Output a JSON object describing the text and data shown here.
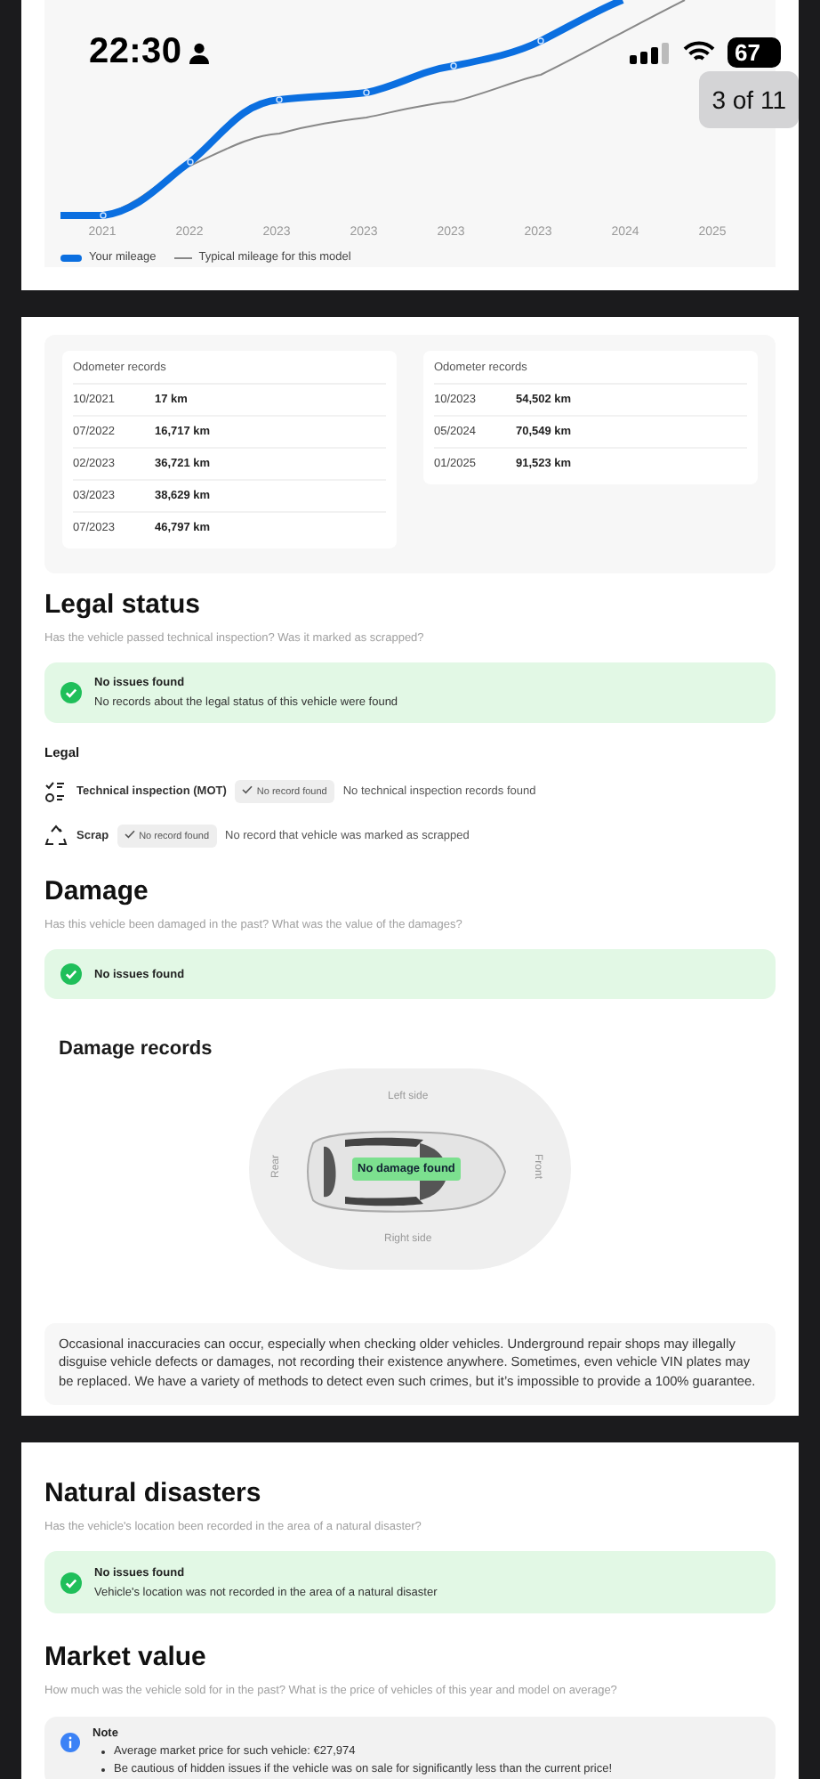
{
  "status_bar": {
    "time": "22:30",
    "battery": "67"
  },
  "page_indicator": "3 of 11",
  "mileage_chart": {
    "x_labels": [
      "2021",
      "2022",
      "2023",
      "2023",
      "2023",
      "2023",
      "2024",
      "2025"
    ],
    "legend": [
      {
        "label": "Your mileage",
        "kind": "user"
      },
      {
        "label": "Typical mileage for this model",
        "kind": "typical"
      }
    ]
  },
  "odometer": {
    "tables": [
      {
        "title": "Odometer records",
        "rows": [
          {
            "date": "10/2021",
            "km": "17 km"
          },
          {
            "date": "07/2022",
            "km": "16,717 km"
          },
          {
            "date": "02/2023",
            "km": "36,721 km"
          },
          {
            "date": "03/2023",
            "km": "38,629 km"
          },
          {
            "date": "07/2023",
            "km": "46,797 km"
          }
        ]
      },
      {
        "title": "Odometer records",
        "rows": [
          {
            "date": "10/2023",
            "km": "54,502 km"
          },
          {
            "date": "05/2024",
            "km": "70,549 km"
          },
          {
            "date": "01/2025",
            "km": "91,523 km"
          }
        ]
      }
    ]
  },
  "legal_status": {
    "title": "Legal status",
    "subtitle": "Has the vehicle passed technical inspection? Was it marked as scrapped?",
    "result": {
      "title": "No issues found",
      "detail": "No records about the legal status of this vehicle were found"
    },
    "group_title": "Legal",
    "items": [
      {
        "kind": "inspection",
        "name": "Technical inspection (MOT)",
        "chip": "No record found",
        "description": "No technical inspection records found"
      },
      {
        "kind": "scrap",
        "name": "Scrap",
        "chip": "No record found",
        "description": "No record that vehicle was marked as scrapped"
      }
    ]
  },
  "damage": {
    "title": "Damage",
    "subtitle": "Has this vehicle been damaged in the past? What was the value of the damages?",
    "result": {
      "title": "No issues found"
    },
    "records_title": "Damage records",
    "diagram": {
      "left": "Left side",
      "right": "Right side",
      "rear": "Rear",
      "front": "Front",
      "status": "No damage found"
    },
    "disclaimer": "Occasional inaccuracies can occur, especially when checking older vehicles. Underground repair shops may illegally disguise vehicle defects or damages, not recording their existence anywhere. Sometimes, even vehicle VIN plates may be replaced. We have a variety of methods to detect even such crimes, but it’s impossible to provide a 100% guarantee."
  },
  "natural_disasters": {
    "title": "Natural disasters",
    "subtitle": "Has the vehicle's location been recorded in the area of a natural disaster?",
    "result": {
      "title": "No issues found",
      "detail": "Vehicle's location was not recorded in the area of a natural disaster"
    }
  },
  "market_value": {
    "title": "Market value",
    "subtitle": "How much was the vehicle sold for in the past? What is the price of vehicles of this year and model on average?",
    "note": {
      "title": "Note",
      "bullets": [
        "Average market price for such vehicle: €27,974",
        "Be cautious of hidden issues if the vehicle was on sale for significantly less than the current price!"
      ]
    }
  }
}
